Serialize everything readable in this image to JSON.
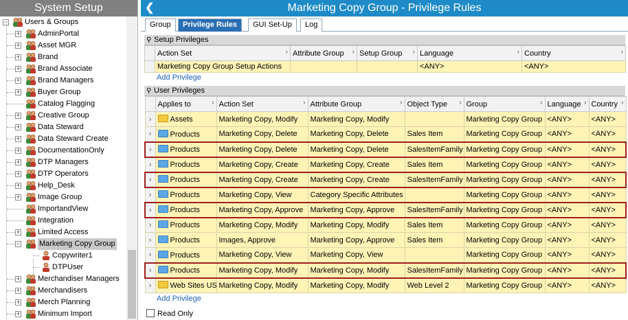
{
  "left_panel": {
    "title": "System Setup",
    "root_label": "Users & Groups",
    "groups": [
      "AdminPortal",
      "Asset MGR",
      "Brand",
      "Brand Associate",
      "Brand Managers",
      "Buyer Group",
      "Catalog Flagging",
      "Creative Group",
      "Data Steward",
      "Data Steward Create",
      "DocumentationOnly",
      "DTP Managers",
      "DTP Operators",
      "Help_Desk",
      "Image Group",
      "ImportandView",
      "Integration",
      "Limited Access",
      "Marketing Copy Group",
      "Copywriter1",
      "DTPUser",
      "Merchandiser Managers",
      "Merchandisers",
      "Merch Planning",
      "Minimum Import"
    ],
    "selected": "Marketing Copy Group"
  },
  "header": {
    "back_icon": "chevron-left-icon",
    "title": "Marketing Copy Group - Privilege Rules"
  },
  "tabs": [
    "Group",
    "Privilege Rules",
    "GUI Set-Up",
    "Log"
  ],
  "active_tab": "Privilege Rules",
  "setup_privileges": {
    "section_title": "Setup Privileges",
    "columns": [
      "Action Set",
      "Attribute Group",
      "Setup Group",
      "Language",
      "Country"
    ],
    "rows": [
      [
        "Marketing Copy Group Setup Actions",
        "",
        "",
        "<ANY>",
        "<ANY>"
      ]
    ],
    "add_link": "Add Privilege"
  },
  "user_privileges": {
    "section_title": "User Privileges",
    "columns": [
      "Applies to",
      "Action Set",
      "Attribute Group",
      "Object Type",
      "Group",
      "Language",
      "Country"
    ],
    "rows": [
      {
        "folder": "yellow",
        "cells": [
          "Assets",
          "Marketing Copy, Modify",
          "Marketing Copy, Modify",
          "",
          "Marketing Copy Group",
          "<ANY>",
          "<ANY>"
        ],
        "hl": false
      },
      {
        "folder": "blue",
        "cells": [
          "Products",
          "Marketing Copy, Delete",
          "Marketing Copy, Delete",
          "Sales Item",
          "Marketing Copy Group",
          "<ANY>",
          "<ANY>"
        ],
        "hl": false
      },
      {
        "folder": "blue",
        "cells": [
          "Products",
          "Marketing Copy, Delete",
          "Marketing Copy, Delete",
          "SalesItemFamily",
          "Marketing Copy Group",
          "<ANY>",
          "<ANY>"
        ],
        "hl": true
      },
      {
        "folder": "blue",
        "cells": [
          "Products",
          "Marketing Copy, Create",
          "Marketing Copy, Create",
          "Sales Item",
          "Marketing Copy Group",
          "<ANY>",
          "<ANY>"
        ],
        "hl": false
      },
      {
        "folder": "blue",
        "cells": [
          "Products",
          "Marketing Copy, Create",
          "Marketing Copy, Create",
          "SalesItemFamily",
          "Marketing Copy Group",
          "<ANY>",
          "<ANY>"
        ],
        "hl": true
      },
      {
        "folder": "blue",
        "cells": [
          "Products",
          "Marketing Copy, View",
          "Category Specific Attributes",
          "",
          "Marketing Copy Group",
          "<ANY>",
          "<ANY>"
        ],
        "hl": false
      },
      {
        "folder": "blue",
        "cells": [
          "Products",
          "Marketing Copy, Approve",
          "Marketing Copy, Approve",
          "SalesItemFamily",
          "Marketing Copy Group",
          "<ANY>",
          "<ANY>"
        ],
        "hl": true
      },
      {
        "folder": "blue",
        "cells": [
          "Products",
          "Marketing Copy, Modify",
          "Marketing Copy, Modify",
          "Sales Item",
          "Marketing Copy Group",
          "<ANY>",
          "<ANY>"
        ],
        "hl": false
      },
      {
        "folder": "blue",
        "cells": [
          "Products",
          "Images, Approve",
          "Marketing Copy, Approve",
          "Sales Item",
          "Marketing Copy Group",
          "<ANY>",
          "<ANY>"
        ],
        "hl": false
      },
      {
        "folder": "blue",
        "cells": [
          "Products",
          "Marketing Copy, View",
          "Marketing Copy, View",
          "",
          "Marketing Copy Group",
          "<ANY>",
          "<ANY>"
        ],
        "hl": false
      },
      {
        "folder": "blue",
        "cells": [
          "Products",
          "Marketing Copy, Modify",
          "Marketing Copy, Modify",
          "SalesItemFamily",
          "Marketing Copy Group",
          "<ANY>",
          "<ANY>"
        ],
        "hl": true
      },
      {
        "folder": "yellow",
        "cells": [
          "Web Sites US",
          "Marketing Copy, Modify",
          "Marketing Copy, Modify",
          "Web Level 2",
          "Marketing Copy Group",
          "<ANY>",
          "<ANY>"
        ],
        "hl": false
      }
    ],
    "add_link": "Add Privilege"
  },
  "read_only_label": "Read Only",
  "colors": {
    "header_blue": "#1e8bc8",
    "active_tab": "#2a6eb3",
    "row_yellow": "#fff3b5",
    "highlight_red": "#a01d1d"
  }
}
